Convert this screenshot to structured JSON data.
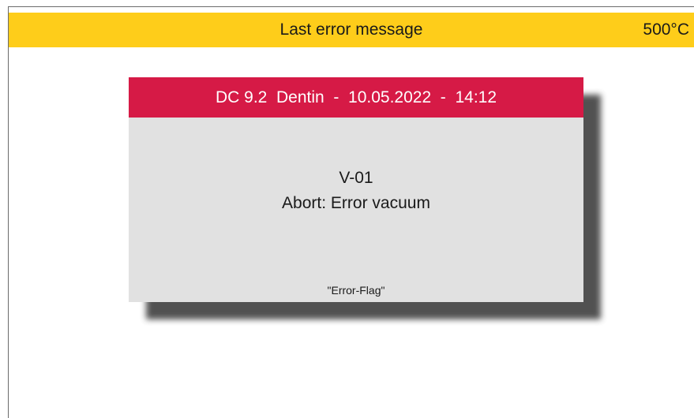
{
  "header": {
    "title": "Last error message",
    "temperature": "500°C",
    "background_color": "#fecd1a"
  },
  "dialog": {
    "title": "DC 9.2  Dentin  -  10.05.2022  -  14:12",
    "header_color": "#d61a46",
    "error_code": "V-01",
    "error_message": "Abort: Error vacuum",
    "flag": "\"Error-Flag\""
  }
}
